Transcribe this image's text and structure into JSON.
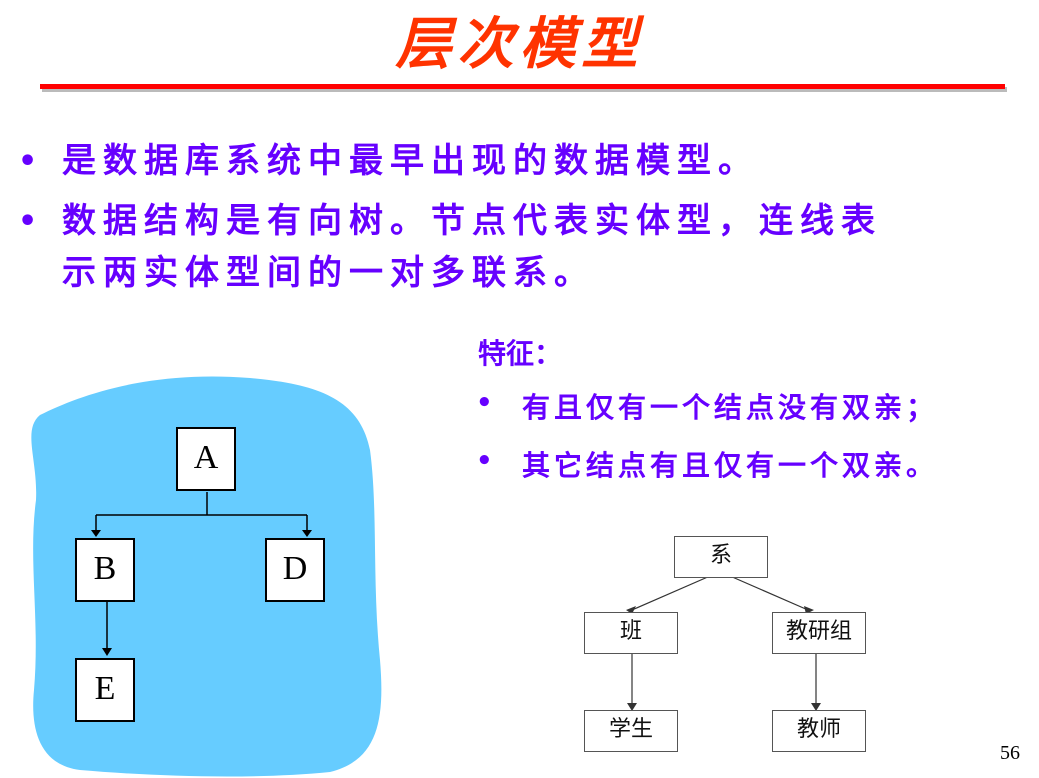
{
  "title": "层次模型",
  "bullets": [
    "是数据库系统中最早出现的数据模型。",
    "数据结构是有向树。节点代表实体型，连线表",
    "示两实体型间的一对多联系。"
  ],
  "features": {
    "title": "特征：",
    "items": [
      "有且仅有一个结点没有双亲；",
      "其它结点有且仅有一个双亲。"
    ]
  },
  "diagram_left": {
    "nodes": {
      "a": "A",
      "b": "B",
      "d": "D",
      "e": "E"
    },
    "blob_color": "#66ccff"
  },
  "diagram_right": {
    "nodes": {
      "root": "系",
      "class": "班",
      "group": "教研组",
      "student": "学生",
      "teacher": "教师"
    }
  },
  "page_number": "56",
  "colors": {
    "title": "#ff3300",
    "text": "#6600ff",
    "rule": "#ff0000"
  }
}
